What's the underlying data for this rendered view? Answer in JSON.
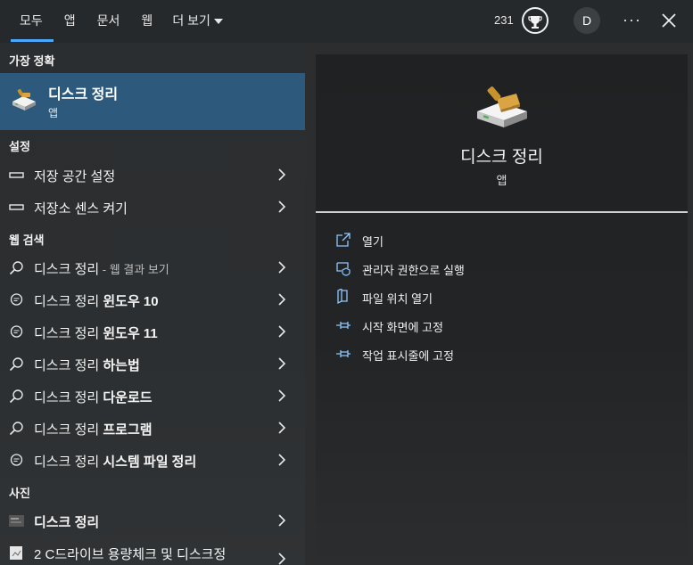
{
  "tabs": [
    {
      "label": "모두"
    },
    {
      "label": "앱"
    },
    {
      "label": "문서"
    },
    {
      "label": "웹"
    },
    {
      "label": "더 보기"
    }
  ],
  "header": {
    "points": "231",
    "avatar_initial": "D",
    "more_label": "···"
  },
  "sections": {
    "best": "가장 정확",
    "settings": "설정",
    "web": "웹 검색",
    "photos": "사진"
  },
  "best_match": {
    "title": "디스크 정리",
    "subtitle": "앱"
  },
  "settings_items": [
    {
      "label": "저장 공간 설정"
    },
    {
      "label": "저장소 센스 켜기"
    }
  ],
  "web_items": [
    {
      "prefix": "디스크 정리",
      "bold": "",
      "suffix": " - 웹 결과 보기"
    },
    {
      "prefix": "디스크 정리 ",
      "bold": "윈도우 10",
      "suffix": ""
    },
    {
      "prefix": "디스크 정리 ",
      "bold": "윈도우 11",
      "suffix": ""
    },
    {
      "prefix": "디스크 정리 ",
      "bold": "하는법",
      "suffix": ""
    },
    {
      "prefix": "디스크 정리 ",
      "bold": "다운로드",
      "suffix": ""
    },
    {
      "prefix": "디스크 정리 ",
      "bold": "프로그램",
      "suffix": ""
    },
    {
      "prefix": "디스크 정리 ",
      "bold": "시스템 파일 정리",
      "suffix": ""
    }
  ],
  "photo_items": [
    {
      "label": "디스크 정리"
    },
    {
      "label": "2 C드라이브 용량체크 및 디스크정"
    }
  ],
  "preview": {
    "title": "디스크 정리",
    "subtitle": "앱",
    "actions": [
      {
        "label": "열기",
        "icon": "open-icon"
      },
      {
        "label": "관리자 권한으로 실행",
        "icon": "shield-icon"
      },
      {
        "label": "파일 위치 열기",
        "icon": "file-location-icon"
      },
      {
        "label": "시작 화면에 고정",
        "icon": "pin-icon"
      },
      {
        "label": "작업 표시줄에 고정",
        "icon": "pin-icon"
      }
    ]
  },
  "colors": {
    "accent": "#4aa8ff",
    "selection": "#2d5a7c",
    "icon_accent": "#8ec7ff"
  }
}
